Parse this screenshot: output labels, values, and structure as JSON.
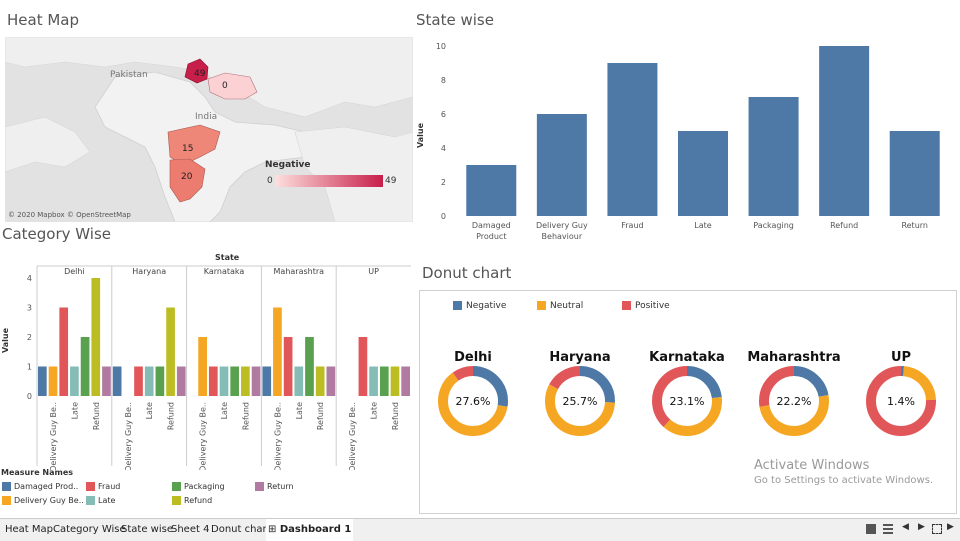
{
  "heatmap": {
    "title": "Heat Map",
    "labels": {
      "country1": "Pakistan",
      "country2": "India"
    },
    "values": [
      {
        "name": "Delhi",
        "value": "49"
      },
      {
        "name": "UP",
        "value": "0"
      },
      {
        "name": "Maharashtra",
        "value": "15"
      },
      {
        "name": "Karnataka",
        "value": "20"
      }
    ],
    "legend_title": "Negative",
    "legend_min": "0",
    "legend_max": "49",
    "attribution": "© 2020 Mapbox © OpenStreetMap",
    "colors": {
      "low": "#fde0dd",
      "high": "#c81e4a"
    }
  },
  "statewise": {
    "title": "State wise",
    "ylabel": "Value",
    "bar_color": "#4e79a7"
  },
  "category": {
    "title": "Category Wise",
    "header": "State",
    "ylabel": "Value",
    "panels": [
      "Delhi",
      "Haryana",
      "Karnataka",
      "Maharashtra",
      "UP"
    ],
    "legend_title": "Measure Names",
    "legend_items": [
      {
        "label": "Damaged Prod..",
        "color": "#4e79a7"
      },
      {
        "label": "Fraud",
        "color": "#e15759"
      },
      {
        "label": "Packaging",
        "color": "#59a14f"
      },
      {
        "label": "Return",
        "color": "#b07aa1"
      },
      {
        "label": "Delivery Guy Be..",
        "color": "#f5a623"
      },
      {
        "label": "Late",
        "color": "#86bcb6"
      },
      {
        "label": "Refund",
        "color": "#bcbd22"
      }
    ]
  },
  "donut": {
    "title": "Donut chart",
    "legend": [
      {
        "label": "Negative",
        "color": "#4e79a7"
      },
      {
        "label": "Neutral",
        "color": "#f5a623"
      },
      {
        "label": "Positive",
        "color": "#e15759"
      }
    ]
  },
  "chart_data": [
    {
      "type": "bar",
      "title": "State wise",
      "ylabel": "Value",
      "categories": [
        "Damaged Product",
        "Delivery Guy Behaviour",
        "Fraud",
        "Late",
        "Packaging",
        "Refund",
        "Return"
      ],
      "values": [
        3,
        6,
        9,
        5,
        7,
        10,
        5
      ],
      "ylim": [
        0,
        10
      ],
      "yticks": [
        0,
        2,
        4,
        6,
        8,
        10
      ]
    },
    {
      "type": "bar",
      "title": "Category Wise",
      "ylabel": "Value",
      "facet": "State",
      "ylim": [
        0,
        4
      ],
      "yticks": [
        0,
        1,
        2,
        3,
        4
      ],
      "series_order": [
        "Damaged Prod..",
        "Delivery Guy Be..",
        "Fraud",
        "Late",
        "Packaging",
        "Refund",
        "Return"
      ],
      "colors": [
        "#4e79a7",
        "#f5a623",
        "#e15759",
        "#86bcb6",
        "#59a14f",
        "#bcbd22",
        "#b07aa1"
      ],
      "xticks": [
        "Delivery Guy Be..",
        "Late",
        "Refund"
      ],
      "panels": [
        {
          "name": "Delhi",
          "values": [
            1,
            1,
            3,
            1,
            2,
            4,
            1
          ]
        },
        {
          "name": "Haryana",
          "values": [
            1,
            0,
            1,
            1,
            1,
            3,
            1
          ]
        },
        {
          "name": "Karnataka",
          "values": [
            0,
            2,
            1,
            1,
            1,
            1,
            1
          ]
        },
        {
          "name": "Maharashtra",
          "values": [
            1,
            3,
            2,
            1,
            2,
            1,
            1
          ]
        },
        {
          "name": "UP",
          "values": [
            0,
            0,
            2,
            1,
            1,
            1,
            1
          ]
        }
      ]
    },
    {
      "type": "pie",
      "subtype": "donut",
      "title": "Donut chart",
      "charts": [
        {
          "name": "Delhi",
          "label": "27.6%",
          "negative": 27.6,
          "neutral": 62.4,
          "positive": 10.0
        },
        {
          "name": "Haryana",
          "label": "25.7%",
          "negative": 25.7,
          "neutral": 57.1,
          "positive": 17.2
        },
        {
          "name": "Karnataka",
          "label": "23.1%",
          "negative": 23.1,
          "neutral": 38.5,
          "positive": 38.4
        },
        {
          "name": "Maharashtra",
          "label": "22.2%",
          "negative": 22.2,
          "neutral": 50.0,
          "positive": 27.8
        },
        {
          "name": "UP",
          "label": "1.4%",
          "negative": 1.4,
          "neutral": 23.0,
          "positive": 75.6
        }
      ]
    }
  ],
  "watermark": {
    "line1": "Activate Windows",
    "line2": "Go to Settings to activate Windows."
  },
  "tabs": [
    {
      "label": "Heat Map"
    },
    {
      "label": "Category Wise"
    },
    {
      "label": "State wise"
    },
    {
      "label": "Sheet 4"
    },
    {
      "label": "Donut chart"
    },
    {
      "label": "Dashboard 1"
    }
  ],
  "nav_icons": [
    "grid-view-icon",
    "list-view-icon",
    "first-page-icon",
    "previous-page-icon",
    "fit-screen-icon",
    "next-page-icon"
  ]
}
